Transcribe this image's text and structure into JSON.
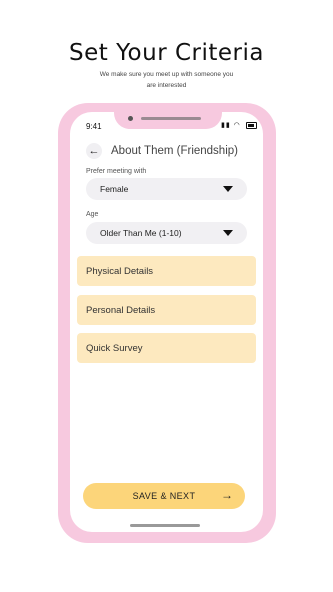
{
  "promo": {
    "headline": "Set Your Criteria",
    "subline_1": "We make sure you meet up with someone you",
    "subline_2": "are interested"
  },
  "status_bar": {
    "time": "9:41"
  },
  "header": {
    "back_icon": "arrow-left-icon",
    "title": "About Them (Friendship)"
  },
  "form": {
    "prefer_label": "Prefer meeting with",
    "prefer_value": "Female",
    "age_label": "Age",
    "age_value": "Older Than Me (1-10)"
  },
  "sections": [
    {
      "label": "Physical Details"
    },
    {
      "label": "Personal Details"
    },
    {
      "label": "Quick Survey"
    }
  ],
  "footer": {
    "save_label": "SAVE & NEXT",
    "arrow_icon": "arrow-right-icon"
  },
  "colors": {
    "phone_frame": "#f7c9df",
    "section_bg": "#fde9bf",
    "button_bg": "#fcd57a"
  }
}
